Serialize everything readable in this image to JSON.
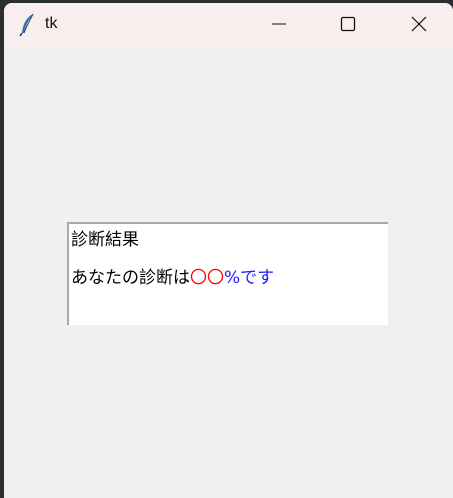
{
  "window": {
    "title": "tk",
    "app_icon": "tk-feather-icon"
  },
  "titlebar_buttons": {
    "minimize_icon": "minimize-icon",
    "maximize_icon": "maximize-icon",
    "close_icon": "close-icon"
  },
  "result": {
    "heading": "診断結果",
    "prefix": "あなたの診断は",
    "value": "〇〇",
    "suffix": "%です"
  },
  "colors": {
    "titlebar_bg": "#f9eeee",
    "window_bg": "#f0f0f0",
    "text_bg": "#ffffff",
    "value_color": "#ff0000",
    "suffix_color": "#1a1aff"
  }
}
